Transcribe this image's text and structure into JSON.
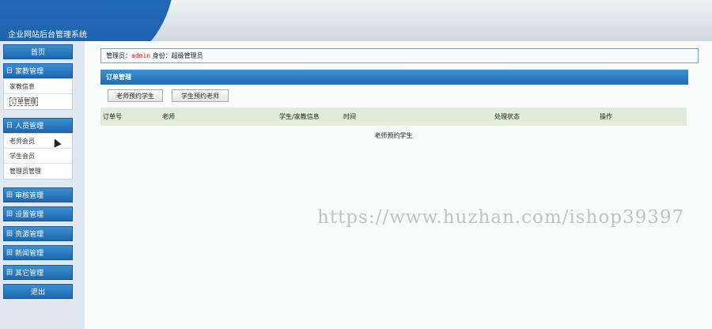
{
  "header": {
    "title": "企业网站后台管理系统"
  },
  "sidebar": {
    "home": "首页",
    "groups": [
      {
        "sign": "日",
        "label": "家教管理",
        "items": [
          "家教信息",
          "订单管理"
        ]
      },
      {
        "sign": "日",
        "label": "人员管理",
        "items": [
          "老师会员",
          "学生会员",
          "管理员管理"
        ]
      },
      {
        "sign": "田",
        "label": "审核管理"
      },
      {
        "sign": "田",
        "label": "设置管理"
      },
      {
        "sign": "田",
        "label": "资源管理"
      },
      {
        "sign": "田",
        "label": "新闻管理"
      },
      {
        "sign": "田",
        "label": "其它管理"
      }
    ],
    "logout": "退出"
  },
  "info": {
    "admin_label": "管理员：",
    "admin_name": "admin",
    "role_label": " 身份：",
    "role": "超级管理员"
  },
  "panel": {
    "title": "订单管理"
  },
  "buttons": {
    "teacher_book_student": "老师预约学生",
    "student_book_teacher": "学生预约老师"
  },
  "table": {
    "columns": [
      "订单号",
      "老师",
      "学生/家教信息",
      "时间",
      "处理状态",
      "操作"
    ]
  },
  "empty_message": "老师预约学生",
  "watermark": "https://www.huzhan.com/ishop39397"
}
